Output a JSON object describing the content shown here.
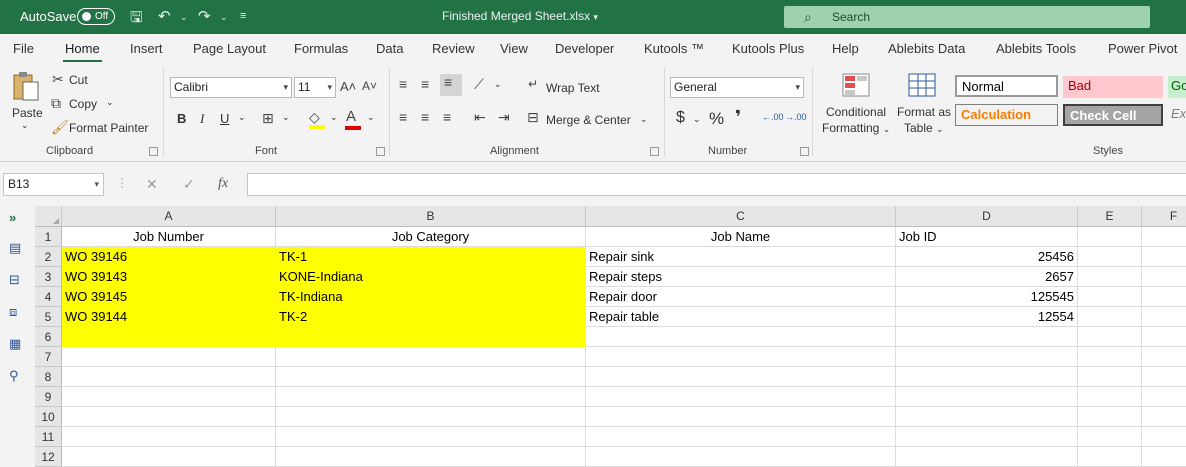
{
  "titlebar": {
    "autosave_label": "AutoSave",
    "autosave_state": "Off",
    "document_name": "Finished Merged Sheet.xlsx",
    "search_placeholder": "Search",
    "brand_color": "#217346"
  },
  "menu_tabs": [
    "File",
    "Home",
    "Insert",
    "Page Layout",
    "Formulas",
    "Data",
    "Review",
    "View",
    "Developer",
    "Kutools ™",
    "Kutools Plus",
    "Help",
    "Ablebits Data",
    "Ablebits Tools",
    "Power Pivot"
  ],
  "active_tab": "Home",
  "ribbon": {
    "clipboard": {
      "label": "Clipboard",
      "paste": "Paste",
      "cut": "Cut",
      "copy": "Copy",
      "format_painter": "Format Painter"
    },
    "font": {
      "label": "Font",
      "font_name": "Calibri",
      "font_size": "11",
      "bold": "B",
      "italic": "I",
      "underline": "U"
    },
    "alignment": {
      "label": "Alignment",
      "wrap_text": "Wrap Text",
      "merge_center": "Merge & Center"
    },
    "number": {
      "label": "Number",
      "format": "General",
      "currency": "$",
      "percent": "%",
      "comma": "❜",
      "inc_decimal": ".00",
      "dec_decimal": ".00"
    },
    "styles": {
      "label": "Styles",
      "conditional_formatting_1": "Conditional",
      "conditional_formatting_2": "Formatting",
      "format_as_table_1": "Format as",
      "format_as_table_2": "Table",
      "normal": "Normal",
      "bad": "Bad",
      "good": "Go",
      "calculation": "Calculation",
      "check_cell": "Check Cell",
      "explanatory": "Ex"
    }
  },
  "formula_bar": {
    "name_box": "B13",
    "fx": "fx",
    "formula": ""
  },
  "sheet": {
    "columns": [
      "A",
      "B",
      "C",
      "D",
      "E",
      "F"
    ],
    "rows": [
      {
        "n": "1",
        "a": "Job Number",
        "b": "Job Category",
        "c": "Job Name",
        "d": "Job ID"
      },
      {
        "n": "2",
        "a": "WO 39146",
        "b": "TK-1",
        "c": "Repair sink",
        "d": "25456"
      },
      {
        "n": "3",
        "a": "WO 39143",
        "b": "KONE-Indiana",
        "c": "Repair steps",
        "d": "2657"
      },
      {
        "n": "4",
        "a": "WO 39145",
        "b": "TK-Indiana",
        "c": "Repair door",
        "d": "125545"
      },
      {
        "n": "5",
        "a": "WO 39144",
        "b": "TK-2",
        "c": "Repair table",
        "d": "12554"
      },
      {
        "n": "6",
        "a": "",
        "b": "",
        "c": "",
        "d": ""
      },
      {
        "n": "7",
        "a": "",
        "b": "",
        "c": "",
        "d": ""
      },
      {
        "n": "8",
        "a": "",
        "b": "",
        "c": "",
        "d": ""
      },
      {
        "n": "9",
        "a": "",
        "b": "",
        "c": "",
        "d": ""
      },
      {
        "n": "10",
        "a": "",
        "b": "",
        "c": "",
        "d": ""
      },
      {
        "n": "11",
        "a": "",
        "b": "",
        "c": "",
        "d": ""
      },
      {
        "n": "12",
        "a": "",
        "b": "",
        "c": "",
        "d": ""
      }
    ],
    "highlight_color": "#ffff00"
  }
}
